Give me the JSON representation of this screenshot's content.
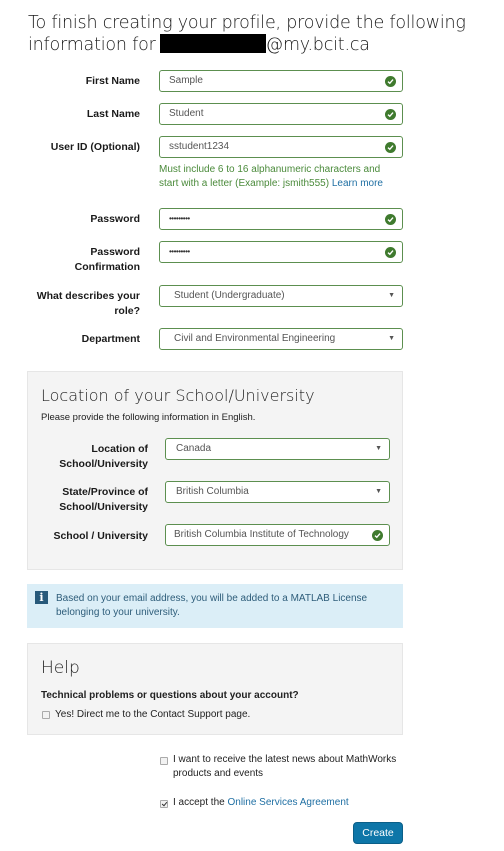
{
  "heading": {
    "line1": "To finish creating your profile, provide the following",
    "line2_prefix": "information for",
    "email_suffix": "@my.bcit.ca"
  },
  "form": {
    "first_name": {
      "label": "First Name",
      "value": "Sample",
      "valid": true
    },
    "last_name": {
      "label": "Last Name",
      "value": "Student",
      "valid": true
    },
    "user_id": {
      "label": "User ID (Optional)",
      "value": "sstudent1234",
      "valid": true,
      "hint": "Must include 6 to 16 alphanumeric characters and start with a letter (Example: jsmith555)",
      "hint_link": "Learn more"
    },
    "password": {
      "label": "Password",
      "value": "•••••••••",
      "valid": true
    },
    "password_confirm": {
      "label_line1": "Password",
      "label_line2": "Confirmation",
      "value": "•••••••••",
      "valid": true
    },
    "role": {
      "label_line1": "What describes your",
      "label_line2": "role?",
      "value": "Student (Undergraduate)"
    },
    "department": {
      "label": "Department",
      "value": "Civil and Environmental Engineering"
    }
  },
  "location_panel": {
    "title": "Location of your School/University",
    "subtitle": "Please provide the following information in English.",
    "country": {
      "label_line1": "Location of",
      "label_line2": "School/University",
      "value": "Canada"
    },
    "state": {
      "label_line1": "State/Province of",
      "label_line2": "School/University",
      "value": "British Columbia"
    },
    "school": {
      "label": "School / University",
      "value": "British Columbia Institute of Technology",
      "valid": true
    }
  },
  "info_alert": {
    "icon": "info-icon",
    "text": "Based on your email address, you will be added to a MATLAB License belonging to your university."
  },
  "help_panel": {
    "title": "Help",
    "question": "Technical problems or questions about your account?",
    "checkbox_label": "Yes! Direct me to the Contact Support page.",
    "checked": false
  },
  "news_opt_in": {
    "label": "I want to receive the latest news about MathWorks products and events",
    "checked": false
  },
  "agreement": {
    "prefix": "I accept the",
    "link": "Online Services Agreement",
    "checked": true
  },
  "create_button": "Create",
  "colors": {
    "valid_border": "#5c8f4f",
    "valid_icon": "#3f7a2e",
    "link": "#1f6fa3",
    "primary": "#0e76a8",
    "info_bg": "#dbeef7"
  }
}
